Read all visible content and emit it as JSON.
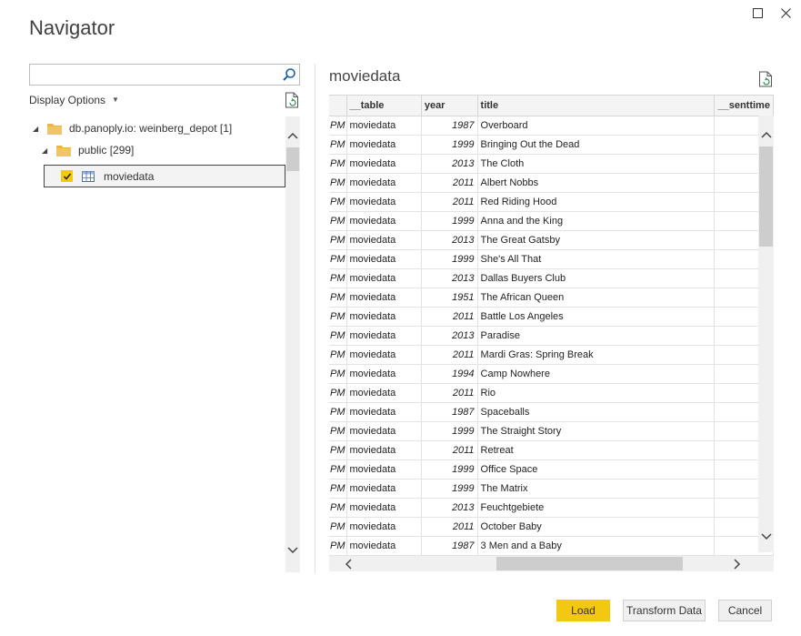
{
  "window": {
    "title": "Navigator",
    "maximize_icon": "maximize-icon",
    "close_icon": "close-icon"
  },
  "left": {
    "search": {
      "value": "",
      "placeholder": ""
    },
    "display_options_label": "Display Options",
    "tree": {
      "server": "db.panoply.io: weinberg_depot [1]",
      "schema": "public [299]",
      "table": "moviedata",
      "table_checked": true
    }
  },
  "preview": {
    "title": "moviedata",
    "columns": [
      "",
      "__table",
      "year",
      "title",
      "__senttime"
    ],
    "rows": [
      [
        "PM",
        "moviedata",
        "1987",
        "Overboard"
      ],
      [
        "PM",
        "moviedata",
        "1999",
        "Bringing Out the Dead"
      ],
      [
        "PM",
        "moviedata",
        "2013",
        "The Cloth"
      ],
      [
        "PM",
        "moviedata",
        "2011",
        "Albert Nobbs"
      ],
      [
        "PM",
        "moviedata",
        "2011",
        "Red Riding Hood"
      ],
      [
        "PM",
        "moviedata",
        "1999",
        "Anna and the King"
      ],
      [
        "PM",
        "moviedata",
        "2013",
        "The Great Gatsby"
      ],
      [
        "PM",
        "moviedata",
        "1999",
        "She's All That"
      ],
      [
        "PM",
        "moviedata",
        "2013",
        "Dallas Buyers Club"
      ],
      [
        "PM",
        "moviedata",
        "1951",
        "The African Queen"
      ],
      [
        "PM",
        "moviedata",
        "2011",
        "Battle Los Angeles"
      ],
      [
        "PM",
        "moviedata",
        "2013",
        "Paradise"
      ],
      [
        "PM",
        "moviedata",
        "2011",
        "Mardi Gras: Spring Break"
      ],
      [
        "PM",
        "moviedata",
        "1994",
        "Camp Nowhere"
      ],
      [
        "PM",
        "moviedata",
        "2011",
        "Rio"
      ],
      [
        "PM",
        "moviedata",
        "1987",
        "Spaceballs"
      ],
      [
        "PM",
        "moviedata",
        "1999",
        "The Straight Story"
      ],
      [
        "PM",
        "moviedata",
        "2011",
        "Retreat"
      ],
      [
        "PM",
        "moviedata",
        "1999",
        "Office Space"
      ],
      [
        "PM",
        "moviedata",
        "1999",
        "The Matrix"
      ],
      [
        "PM",
        "moviedata",
        "2013",
        "Feuchtgebiete"
      ],
      [
        "PM",
        "moviedata",
        "2011",
        "October Baby"
      ],
      [
        "PM",
        "moviedata",
        "1987",
        "3 Men and a Baby"
      ]
    ]
  },
  "buttons": {
    "load": "Load",
    "transform": "Transform Data",
    "cancel": "Cancel"
  },
  "colors": {
    "accent": "#f2c811",
    "folder": "#e8b54a"
  }
}
